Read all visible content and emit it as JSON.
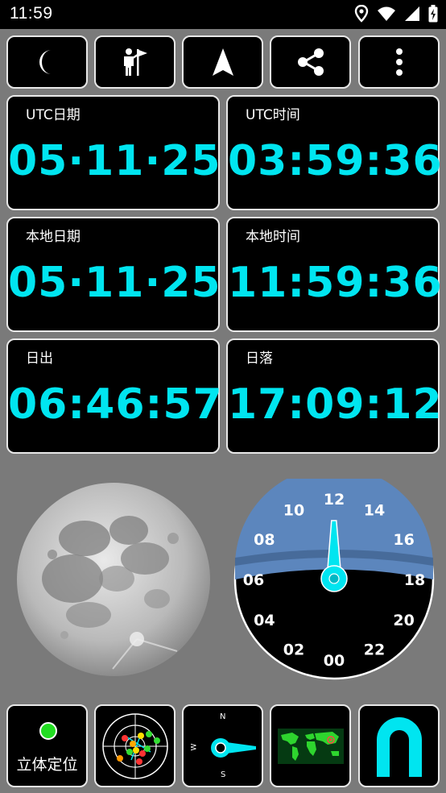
{
  "status_bar": {
    "time": "11:59"
  },
  "toolbar": {
    "buttons": [
      {
        "name": "night-mode-button",
        "icon": "moon-icon"
      },
      {
        "name": "explorer-button",
        "icon": "hiker-flag-icon"
      },
      {
        "name": "navigate-button",
        "icon": "navigation-arrow-icon"
      },
      {
        "name": "share-button",
        "icon": "share-icon"
      },
      {
        "name": "more-button",
        "icon": "more-vert-icon"
      }
    ]
  },
  "cards": {
    "utc_date": {
      "label": "UTC日期",
      "value": "05·11·25"
    },
    "utc_time": {
      "label": "UTC时间",
      "value": "03:59:36"
    },
    "local_date": {
      "label": "本地日期",
      "value": "05·11·25"
    },
    "local_time": {
      "label": "本地时间",
      "value": "11:59:36"
    },
    "sunrise": {
      "label": "日出",
      "value": "06:46:57"
    },
    "sunset": {
      "label": "日落",
      "value": "17:09:12"
    }
  },
  "dial": {
    "hours": [
      "12",
      "14",
      "16",
      "18",
      "20",
      "22",
      "00",
      "02",
      "04",
      "06",
      "08",
      "10"
    ],
    "hand_hour": 11.99
  },
  "bottom": {
    "fix_label": "立体定位",
    "fix_status_color": "#22dd22",
    "compass": {
      "n": "N",
      "s": "S",
      "w": "W"
    }
  },
  "colors": {
    "accent": "#00e5f0",
    "card_border": "#e8e8e8",
    "background": "#7a7a7a"
  }
}
